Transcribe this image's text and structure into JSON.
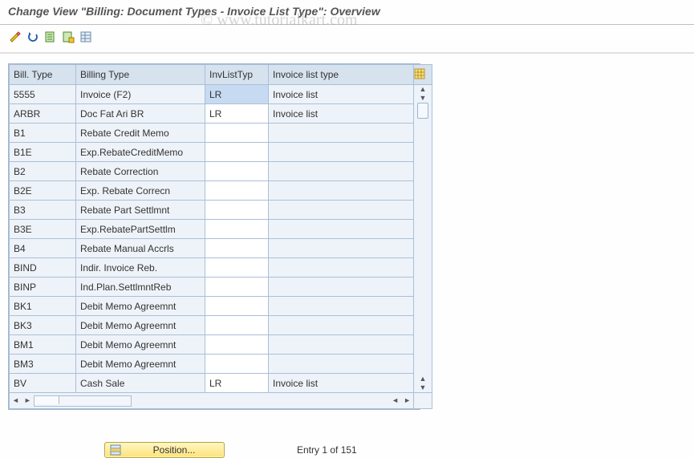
{
  "header": {
    "title": "Change View \"Billing: Document Types - Invoice List Type\": Overview"
  },
  "watermark": "© www.tutorialkart.com",
  "columns": {
    "c0": "Bill. Type",
    "c1": "Billing Type",
    "c2": "InvListTyp",
    "c3": "Invoice list type"
  },
  "rows": [
    {
      "bt": "5555",
      "btxt": "Invoice (F2)",
      "ilt": "LR",
      "iltxt": "Invoice list",
      "sel": true
    },
    {
      "bt": "ARBR",
      "btxt": "Doc Fat Ari BR",
      "ilt": "LR",
      "iltxt": "Invoice list"
    },
    {
      "bt": "B1",
      "btxt": "Rebate Credit Memo",
      "ilt": "",
      "iltxt": ""
    },
    {
      "bt": "B1E",
      "btxt": "Exp.RebateCreditMemo",
      "ilt": "",
      "iltxt": ""
    },
    {
      "bt": "B2",
      "btxt": "Rebate Correction",
      "ilt": "",
      "iltxt": ""
    },
    {
      "bt": "B2E",
      "btxt": "Exp. Rebate Correcn",
      "ilt": "",
      "iltxt": ""
    },
    {
      "bt": "B3",
      "btxt": "Rebate Part Settlmnt",
      "ilt": "",
      "iltxt": ""
    },
    {
      "bt": "B3E",
      "btxt": "Exp.RebatePartSettlm",
      "ilt": "",
      "iltxt": ""
    },
    {
      "bt": "B4",
      "btxt": "Rebate Manual Accrls",
      "ilt": "",
      "iltxt": ""
    },
    {
      "bt": "BIND",
      "btxt": "Indir. Invoice Reb.",
      "ilt": "",
      "iltxt": ""
    },
    {
      "bt": "BINP",
      "btxt": "Ind.Plan.SettlmntReb",
      "ilt": "",
      "iltxt": ""
    },
    {
      "bt": "BK1",
      "btxt": "Debit Memo Agreemnt",
      "ilt": "",
      "iltxt": ""
    },
    {
      "bt": "BK3",
      "btxt": "Debit Memo Agreemnt",
      "ilt": "",
      "iltxt": ""
    },
    {
      "bt": "BM1",
      "btxt": "Debit Memo Agreemnt",
      "ilt": "",
      "iltxt": ""
    },
    {
      "bt": "BM3",
      "btxt": "Debit Memo Agreemnt",
      "ilt": "",
      "iltxt": ""
    },
    {
      "bt": "BV",
      "btxt": "Cash Sale",
      "ilt": "LR",
      "iltxt": "Invoice list"
    }
  ],
  "footer": {
    "position_label": "Position...",
    "entry_text": "Entry 1 of 151"
  }
}
